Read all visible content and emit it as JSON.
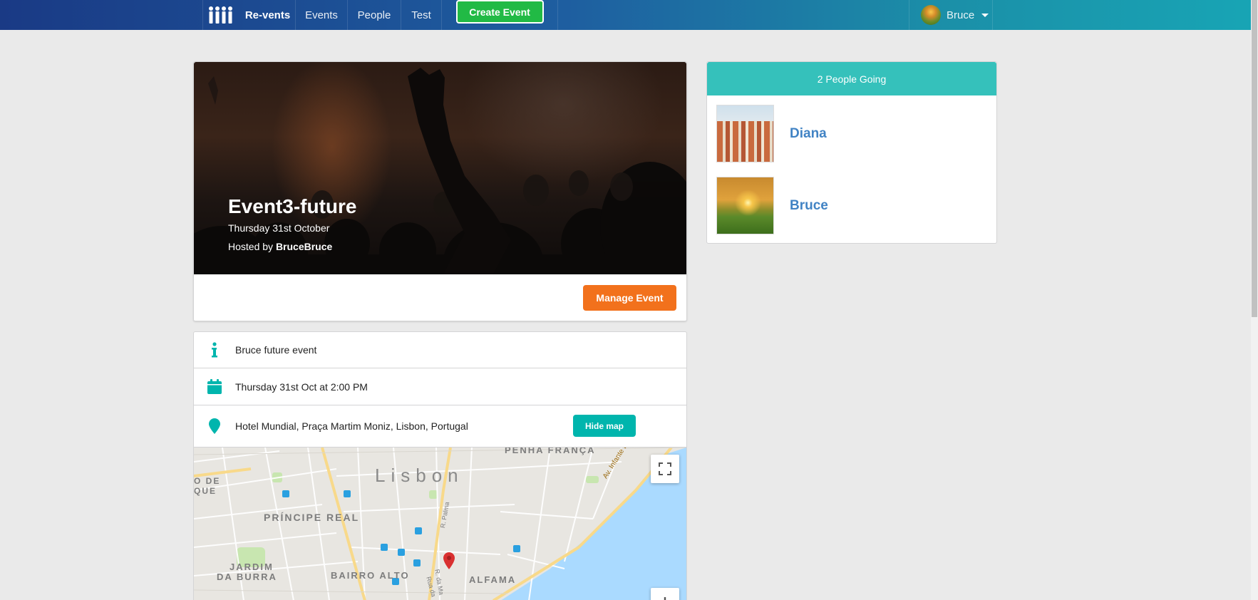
{
  "nav": {
    "brand": "Re-vents",
    "events": "Events",
    "people": "People",
    "test": "Test",
    "create_event": "Create Event",
    "user_name": "Bruce"
  },
  "event": {
    "title": "Event3-future",
    "date": "Thursday 31st October",
    "hosted_by_prefix": "Hosted by ",
    "host": "BruceBruce",
    "manage_label": "Manage Event"
  },
  "details": {
    "description": "Bruce future event",
    "datetime": "Thursday 31st Oct at 2:00 PM",
    "venue": "Hotel Mundial, Praça Martim Moniz, Lisbon, Portugal",
    "hide_map_label": "Hide map"
  },
  "map": {
    "city_label": "Lisbon",
    "labels": [
      "PENHA FRANÇA",
      "PRÍNCIPE REAL",
      "JARDIM",
      "DA BURRA",
      "BAIRRO ALTO",
      "ALFAMA",
      "O DE",
      "QUE",
      "Av. Infante Dom H",
      "R. Palma",
      "R. da Ma",
      "Rua da"
    ],
    "colors": {
      "water": "#aadaff",
      "land": "#e8e6e1",
      "road": "#ffffff",
      "major_road": "#f8d98a",
      "park": "#c8e6b0",
      "pin": "#d93030"
    }
  },
  "attendees": {
    "header": "2 People Going",
    "people": [
      {
        "name": "Diana"
      },
      {
        "name": "Bruce"
      }
    ]
  },
  "colors": {
    "create_btn": "#21ba45",
    "manage_btn": "#f2711c",
    "teal": "#00b5ad",
    "people_header": "#35c1bb",
    "link": "#4183c4"
  }
}
